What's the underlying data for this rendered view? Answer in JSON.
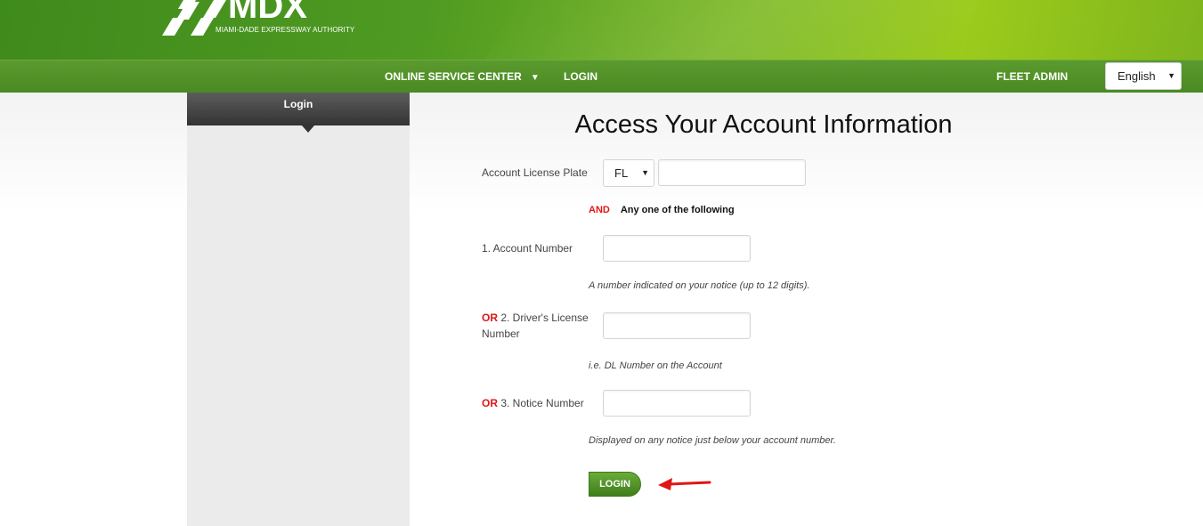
{
  "header": {
    "logo_text": "MDX",
    "logo_subtitle": "MIAMI-DADE EXPRESSWAY AUTHORITY"
  },
  "nav": {
    "online_service_center": "ONLINE SERVICE CENTER",
    "dropdown_caret": "▼",
    "login": "LOGIN",
    "fleet_admin": "FLEET ADMIN",
    "language": "English"
  },
  "sidebar": {
    "tab_label": "Login"
  },
  "form": {
    "title": "Access Your Account Information",
    "license_plate_label": "Account License Plate",
    "state_value": "FL",
    "license_plate_value": "",
    "and_word": "AND",
    "and_text": "Any one of the following",
    "or_word": "OR",
    "account_number_label": "1. Account Number",
    "account_number_value": "",
    "account_number_hint": "A number indicated on your notice (up to 12 digits).",
    "drivers_license_label_1": "2. Driver's License",
    "drivers_license_label_2": "Number",
    "drivers_license_value": "",
    "drivers_license_hint": "i.e. DL Number on the Account",
    "notice_number_label": "3. Notice Number",
    "notice_number_value": "",
    "notice_number_hint": "Displayed on any notice just below your account number.",
    "login_button": "LOGIN"
  },
  "colors": {
    "brand_green": "#4a8a22",
    "accent_red": "#e01616",
    "annotation_arrow": "#e01616"
  }
}
